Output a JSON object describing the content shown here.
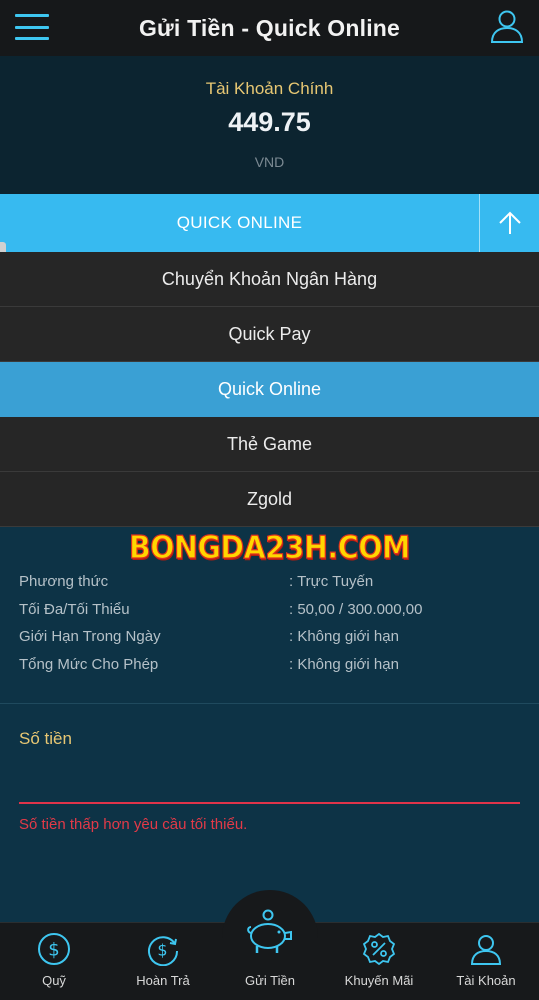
{
  "header": {
    "title": "Gửi Tiền - Quick Online"
  },
  "balance": {
    "label": "Tài Khoản Chính",
    "amount": "449.75",
    "currency": "VND"
  },
  "method": {
    "selected": "QUICK ONLINE",
    "options": [
      "Chuyển Khoản Ngân Hàng",
      "Quick Pay",
      "Quick Online",
      "Thẻ Game",
      "Zgold"
    ],
    "active_index": 2
  },
  "watermark": "BONGDA23H.COM",
  "info": [
    {
      "key": "Phương thức",
      "value": ": Trực Tuyến"
    },
    {
      "key": "Tối Đa/Tối Thiểu",
      "value": ": 50,00 / 300.000,00"
    },
    {
      "key": "Giới Hạn Trong Ngày",
      "value": ": Không giới hạn"
    },
    {
      "key": "Tổng Mức Cho Phép",
      "value": ": Không giới hạn"
    }
  ],
  "amount_field": {
    "label": "Số tiền",
    "value": "",
    "error": "Số tiền thấp hơn yêu cầu tối thiểu."
  },
  "nav": [
    {
      "label": "Quỹ",
      "icon": "dollar-coin-icon"
    },
    {
      "label": "Hoàn Trả",
      "icon": "refund-icon"
    },
    {
      "label": "Gửi Tiền",
      "icon": "piggy-bank-icon"
    },
    {
      "label": "Khuyến Mãi",
      "icon": "percent-badge-icon"
    },
    {
      "label": "Tài Khoản",
      "icon": "user-icon"
    }
  ],
  "colors": {
    "accent": "#37baf0",
    "gold": "#e7c773",
    "error": "#e23a48",
    "active_option": "#3aa0d4"
  }
}
